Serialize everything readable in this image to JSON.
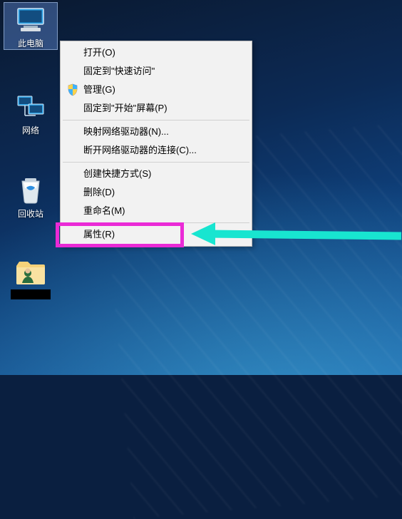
{
  "desktop": {
    "icons": {
      "computer": "此电脑",
      "network": "网络",
      "recycle": "回收站"
    }
  },
  "contextMenu": {
    "open": "打开(O)",
    "pinQuickAccess": "固定到\"快速访问\"",
    "manage": "管理(G)",
    "pinStart": "固定到\"开始\"屏幕(P)",
    "mapDrive": "映射网络驱动器(N)...",
    "disconnectDrive": "断开网络驱动器的连接(C)...",
    "createShortcut": "创建快捷方式(S)",
    "delete": "删除(D)",
    "rename": "重命名(M)",
    "properties": "属性(R)"
  }
}
